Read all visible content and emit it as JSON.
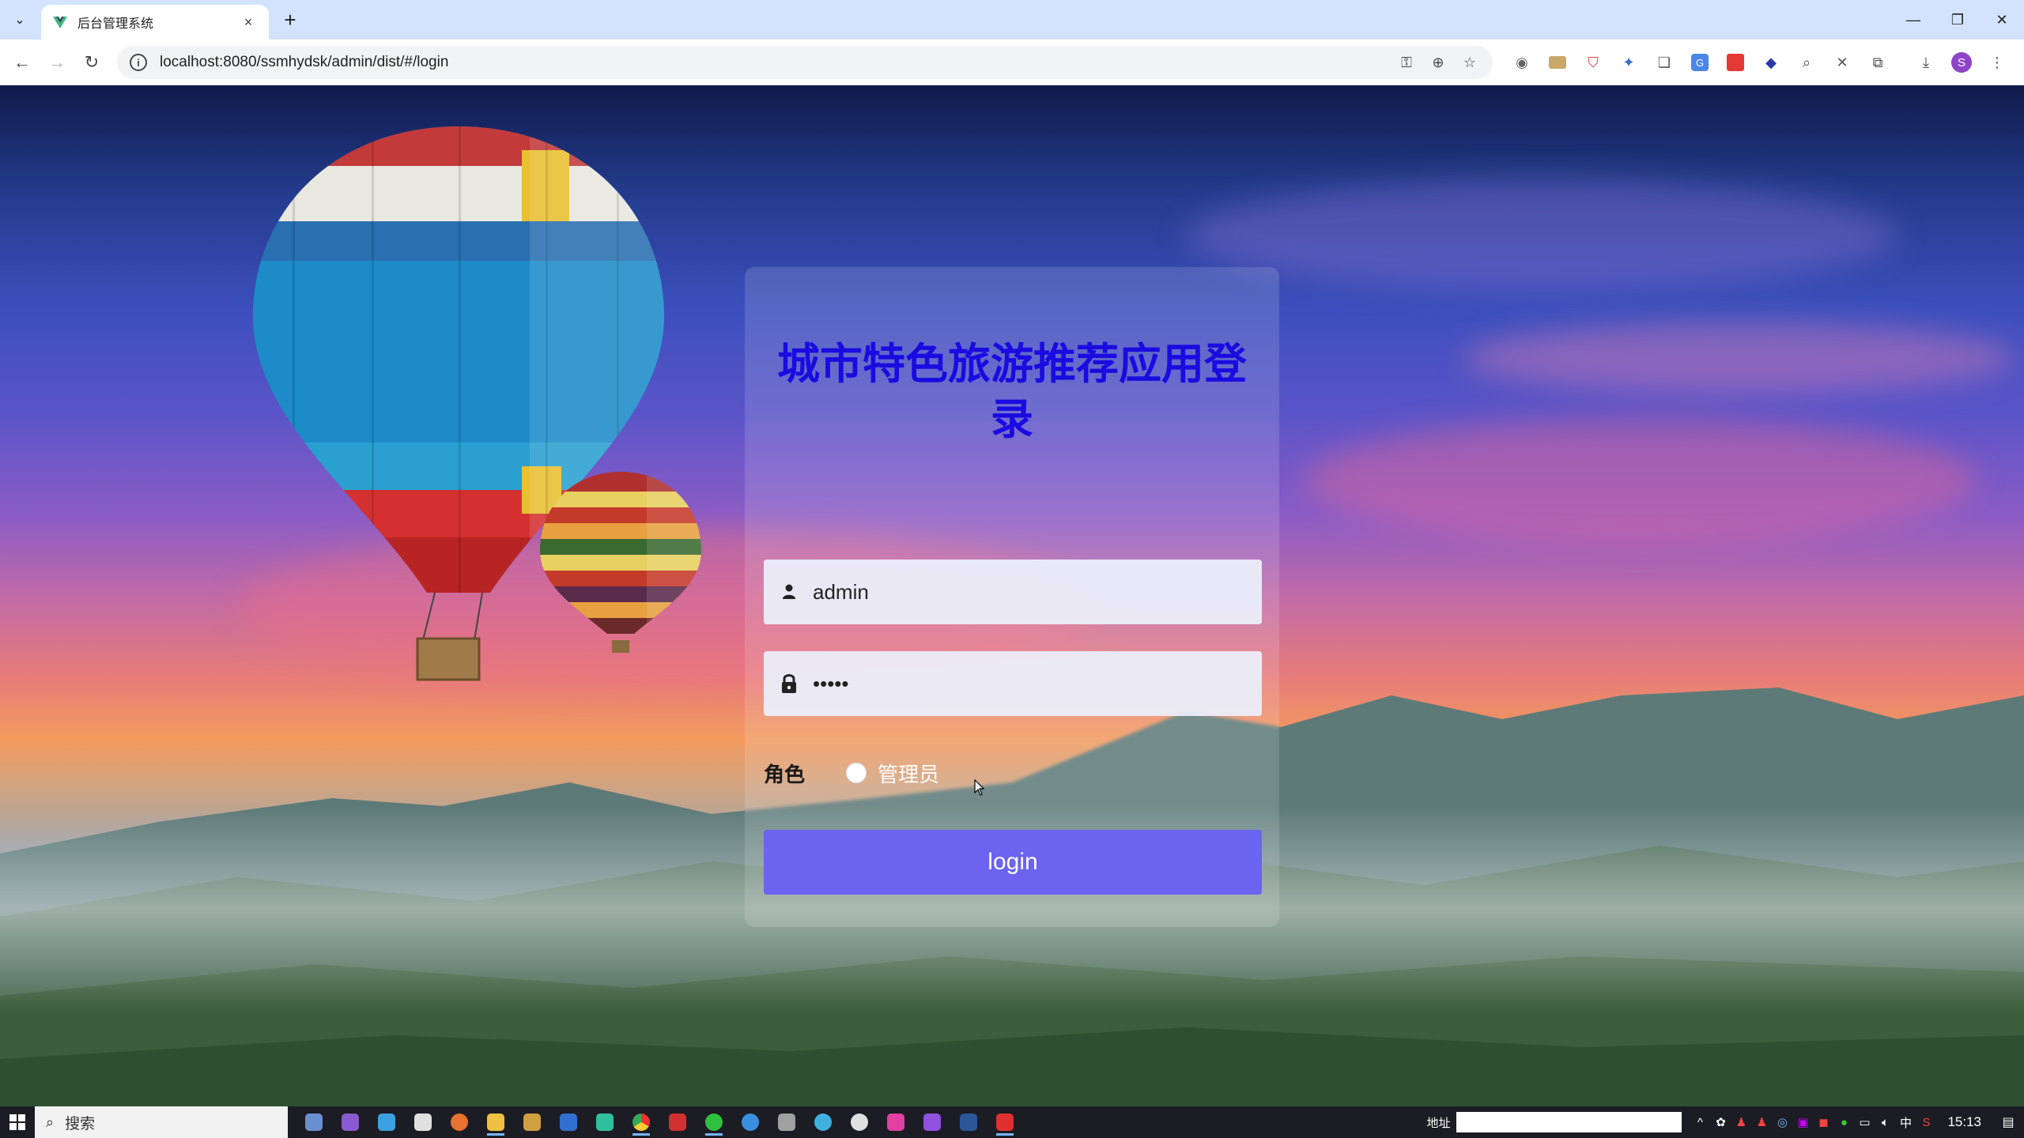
{
  "browser": {
    "tab_title": "后台管理系统",
    "url": "localhost:8080/ssmhydsk/admin/dist/#/login",
    "new_tab": "+",
    "close_tab": "×"
  },
  "login": {
    "title": "城市特色旅游推荐应用登录",
    "username_value": "admin",
    "password_value": "•••••",
    "role_label": "角色",
    "role_option": "管理员",
    "login_button": "login"
  },
  "taskbar": {
    "search_placeholder": "搜索",
    "address_label": "地址",
    "input_method": "中",
    "clock": "15:13"
  },
  "colors": {
    "title": "#1a0be0",
    "button": "#6c63f0",
    "tab_bar": "#d3e3fd"
  }
}
